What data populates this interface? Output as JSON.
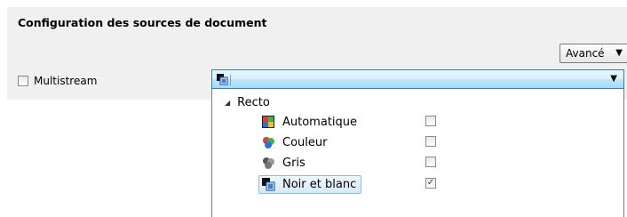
{
  "section": {
    "title": "Configuration des sources de document"
  },
  "advanced_button": {
    "label": "Avancé"
  },
  "multistream": {
    "label": "Multistream",
    "checked": false
  },
  "combo": {
    "selected_icon": "black-white-icon",
    "value": ""
  },
  "tree": {
    "root": {
      "label": "Recto",
      "expanded": true
    },
    "items": [
      {
        "label": "Automatique",
        "icon": "auto-color-icon",
        "checked": false
      },
      {
        "label": "Couleur",
        "icon": "color-icon",
        "checked": false
      },
      {
        "label": "Gris",
        "icon": "gray-icon",
        "checked": false
      },
      {
        "label": "Noir et blanc",
        "icon": "black-white-icon",
        "checked": true,
        "selected": true
      }
    ]
  },
  "check_mark": "✓",
  "colors": {
    "panel_bg": "#f0f0f0",
    "combo_border": "#3c7fb1",
    "selection_border": "#8fbde8"
  }
}
